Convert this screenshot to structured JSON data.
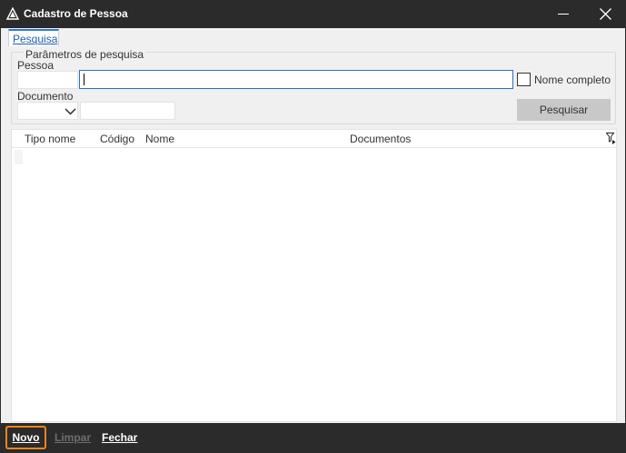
{
  "window": {
    "title": "Cadastro de Pessoa",
    "minimize_icon": "minimize-icon",
    "close_icon": "close-icon"
  },
  "tabs": [
    {
      "label": "Pesquisa"
    }
  ],
  "search_params": {
    "legend": "Parâmetros de pesquisa",
    "pessoa_label": "Pessoa",
    "pessoa_code_value": "",
    "pessoa_name_value": "",
    "nome_completo_label": "Nome completo",
    "nome_completo_checked": false,
    "documento_label": "Documento",
    "documento_type_value": "",
    "documento_value": "",
    "search_button": "Pesquisar"
  },
  "grid": {
    "columns": [
      "Tipo nome",
      "Código",
      "Nome",
      "Documentos"
    ],
    "rows": []
  },
  "bottom_bar": {
    "novo": "Novo",
    "limpar": "Limpar",
    "fechar": "Fechar"
  },
  "colors": {
    "accent": "#2c6fc2",
    "focus_highlight": "#e8861a",
    "titlebar": "#2b2b2b"
  }
}
